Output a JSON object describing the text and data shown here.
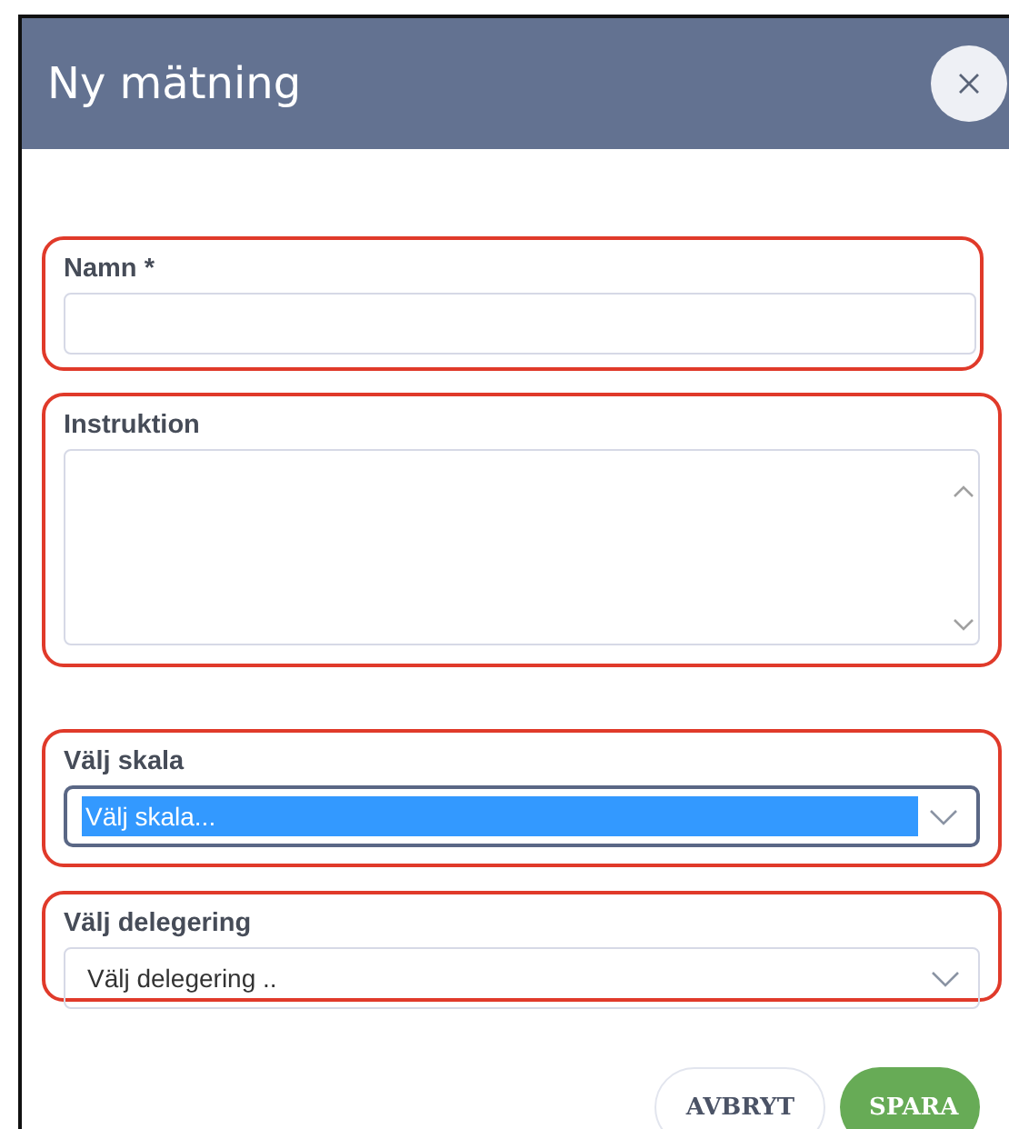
{
  "dialog": {
    "title": "Ny mätning"
  },
  "fields": [
    {
      "kind": "text",
      "label": "Namn *",
      "highlighted": true
    },
    {
      "kind": "textarea",
      "label": "Instruktion",
      "highlighted": true
    },
    {
      "kind": "select",
      "label": "Välj skala",
      "value": "Välj skala...",
      "focused": true,
      "highlighted": true
    },
    {
      "kind": "select",
      "label": "Välj delegering",
      "value": "Välj delegering ..",
      "focused": false,
      "highlighted": true
    }
  ],
  "buttons": [
    {
      "label": "AVBRYT",
      "kind": "secondary"
    },
    {
      "label": "SPARA",
      "kind": "primary"
    }
  ]
}
